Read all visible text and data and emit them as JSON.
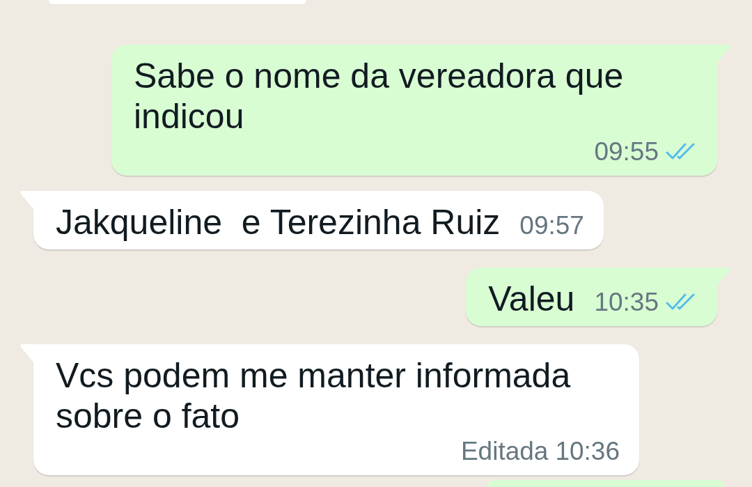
{
  "chat": {
    "messages": [
      {
        "kind": "outgoing",
        "text": "Sabe o nome da vereadora que indicou",
        "time": "09:55",
        "read": true
      },
      {
        "kind": "incoming",
        "text": "Jakqueline  e Terezinha Ruiz",
        "time": "09:57"
      },
      {
        "kind": "outgoing",
        "text": "Valeu",
        "time": "10:35",
        "read": true
      },
      {
        "kind": "incoming",
        "text": "Vcs podem me manter informada sobre o fato",
        "time": "10:36",
        "edited": "Editada"
      }
    ],
    "partial_bubbles": [
      {
        "kind": "incoming"
      },
      {
        "kind": "outgoing"
      }
    ]
  }
}
